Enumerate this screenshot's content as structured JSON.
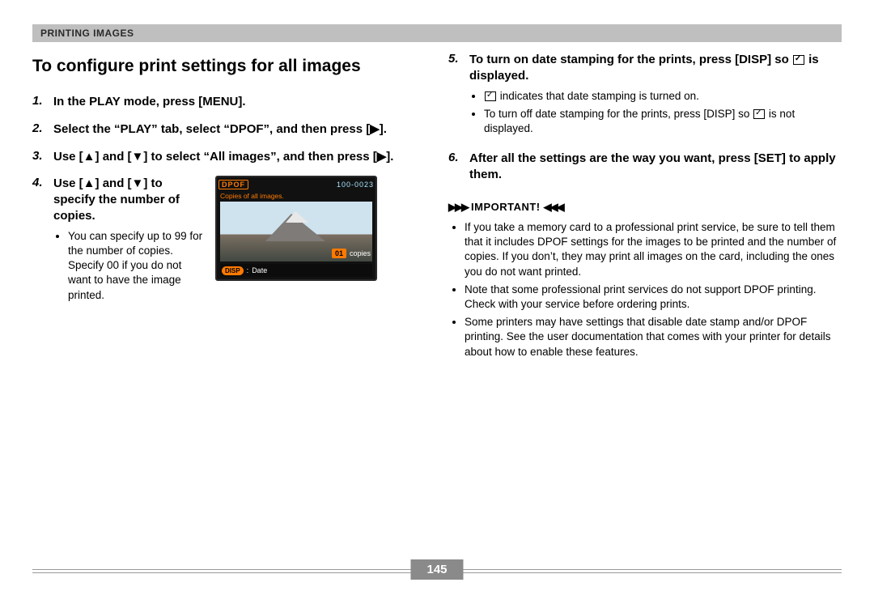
{
  "header": {
    "section": "PRINTING IMAGES"
  },
  "title": "To configure print settings for all images",
  "steps": [
    {
      "num": "1.",
      "text": "In the PLAY mode, press [MENU]."
    },
    {
      "num": "2.",
      "text": "Select the “PLAY” tab, select “DPOF”, and then press [▶]."
    },
    {
      "num": "3.",
      "text": "Use [▲] and [▼] to select “All images”, and then press [▶]."
    },
    {
      "num": "4.",
      "text": "Use [▲] and [▼] to specify the number of copies.",
      "sub": [
        "You can specify up to 99 for the number of copies. Specify 00 if you do not want to have the image printed."
      ]
    },
    {
      "num": "5.",
      "text_pre": "To turn on date stamping for the prints, press [DISP] so ",
      "text_post": " is displayed.",
      "sub5a_post": " indicates that date stamping is turned on.",
      "sub5b_pre": "To turn off date stamping for the prints, press [DISP] so ",
      "sub5b_post": " is not displayed."
    },
    {
      "num": "6.",
      "text": "After all the settings are the way you want, press [SET] to apply them."
    }
  ],
  "lcd": {
    "dpof": "DPOF",
    "counter": "100-0023",
    "subtitle": "Copies of all images.",
    "copies_num": "01",
    "copies_word": "copies",
    "disp": "DISP",
    "colon": ":",
    "date": "Date"
  },
  "important": {
    "label": "IMPORTANT!",
    "deco_r": "▶▶▶",
    "deco_l": "◀◀◀",
    "items": [
      "If you take a memory card to a professional print service, be sure to tell them that it includes DPOF settings for the images to be printed and the number of copies. If you don’t, they may print all images on the card, including the ones you do not want printed.",
      "Note that some professional print services do not support DPOF printing. Check with your service before ordering prints.",
      "Some printers may have settings that disable date stamp and/or DPOF printing. See the user documentation that comes with your printer for details about how to enable these features."
    ]
  },
  "page_number": "145"
}
